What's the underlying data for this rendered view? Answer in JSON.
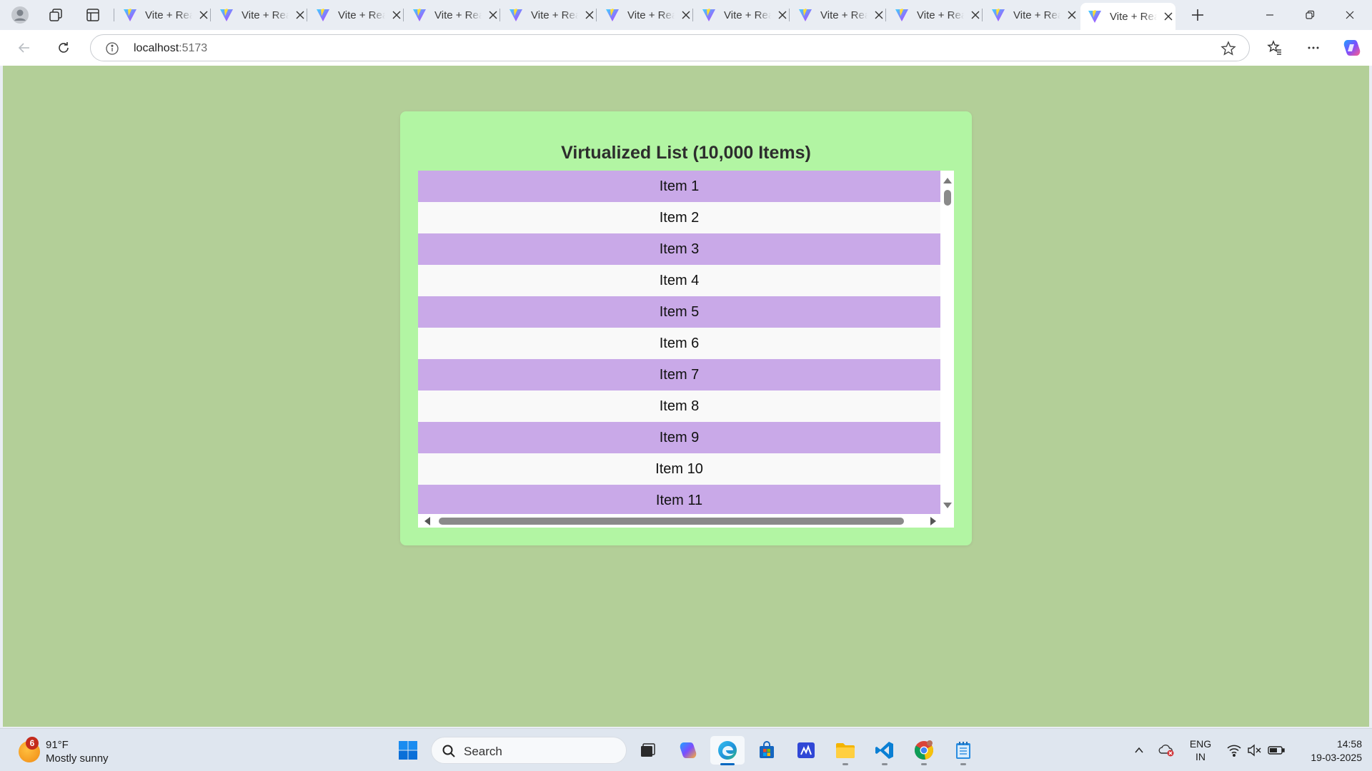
{
  "browser": {
    "tabs": [
      {
        "title": "Vite + React"
      },
      {
        "title": "Vite + React"
      },
      {
        "title": "Vite + React"
      },
      {
        "title": "Vite + React"
      },
      {
        "title": "Vite + React"
      },
      {
        "title": "Vite + React"
      },
      {
        "title": "Vite + React"
      },
      {
        "title": "Vite + React"
      },
      {
        "title": "Vite + React"
      },
      {
        "title": "Vite + React"
      },
      {
        "title": "Vite + React"
      }
    ],
    "address": {
      "host": "localhost",
      "port": ":5173"
    }
  },
  "page": {
    "title": "Virtualized List (10,000 Items)",
    "items": [
      "Item 1",
      "Item 2",
      "Item 3",
      "Item 4",
      "Item 5",
      "Item 6",
      "Item 7",
      "Item 8",
      "Item 9",
      "Item 10",
      "Item 11"
    ],
    "colors": {
      "background": "#b3cf98",
      "card": "#b2f5a3",
      "odd_row": "#c9a9e8",
      "even_row": "#f9f9f9"
    }
  },
  "taskbar": {
    "weather": {
      "temp": "91°F",
      "condition": "Mostly sunny",
      "badge": "6"
    },
    "search_label": "Search",
    "language": {
      "line1": "ENG",
      "line2": "IN"
    },
    "clock": {
      "time": "14:58",
      "date": "19-03-2025"
    },
    "apps": [
      "task-view",
      "copilot",
      "edge",
      "microsoft-store",
      "microsoft-whiteboard",
      "file-explorer",
      "vs-code",
      "chrome",
      "notepad"
    ]
  }
}
